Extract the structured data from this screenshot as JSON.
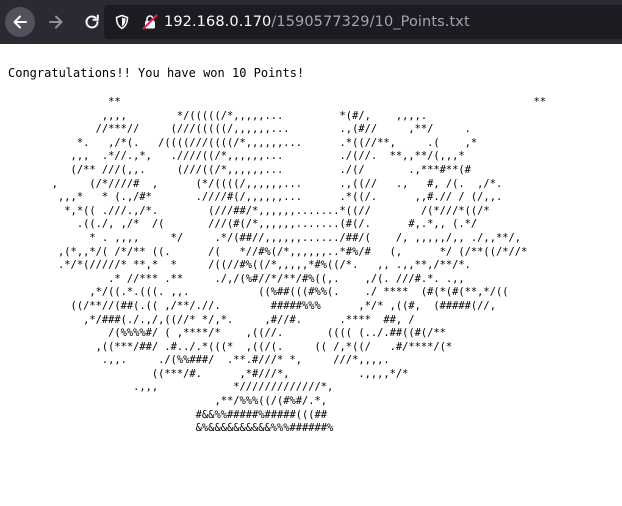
{
  "browser": {
    "url_host": "192.168.0.170",
    "url_path": "/1590577329/10_Points.txt"
  },
  "page": {
    "message": "Congratulations!! You have won 10 Points!",
    "ascii_art": "                **                                                                  **\n               ,,,,        */(((((/*,,,,,...         *(#/,    ,,,,.\n              //***//     (///(((((/,,,,,,...        .,(#//     ,**/     .\n           *.   ,/*(.   /((((///((((/*,,,,,,...      .*((//**,     .(    ,*\n          ,,,  .*//.,*,   .////((/*,,,,,,...         ./(//.  **,,**/(,,,*\n          (/** ///(,,.     (///((/*,,,,,,...         ./(/       .,***#**(#\n       ,     (/*////#  ,      (*/((((/,,,,,,...      .,((//   .,   #, /(.  ,/*.\n        ,,,*   * (.,/#*       .////#(/,,,,,,...      .*((/.      ,,#.// / (/,,.\n         *,*(( .///.,/*.        (///##/*,,,,,,.......*((//        /(*///*((/*\n           .((./, ,/*  /(       ///(#(/*,,,,,,.......(#(/.      #,.*,, (.*/\n             * . ,,,,     */     .*/(##//,,,,,,....../##/(    /, ,,,,,/,, ./,,**/,\n        ,(*,,*/( /*/** ((.      /(   *//#%(/*,,,,,,..*#%/#   (,      */ (/**((/*//*\n        .*/*(/////* **,*  *     /((//#%((/*,,,,,*#%((/*.   ,, .,,**,/**/*.\n                .* //*** .**     ./,/(%#//*/**/#%((,.    ,/(. ///#.*. .,,\n             ,*/((.*.(((. ,,.           ((%##(((#%%(.    ./ ****  (#(*(#(**,*/((\n          ((/**//(##(.(( ,/**/.//.        #####%%%      ,*/* ,((#,  (#####(//,\n            ,*/###(./.,/,((//* */,*.     ,#//#.      .****  ##, /\n                /(%%%%#/ ( ,****/*    ,((//.       (((( (../.##((#(/**\n              ,((***/##/ .#../.*(((*  ,((/(.     (( /,*((/   .#/****/(*\n               .,,.     ./(%%###/  .**.#///* *,     ///*,,,,.\n                       ((***/#.      ,*#///*,           .,,,,*/*\n                    .,,,            */////////////*,\n                                 ,**/%%%((/(#%#/.*,\n                              #&&%%#####%#####(((##\n                              &%&&&&&&&&&&%%%######%"
  },
  "colors": {
    "toolbar_bg": "#2b2a33",
    "urlbar_bg": "#1c1b22",
    "url_host": "#fbfbfe",
    "url_path": "#a4a4ad",
    "page_bg": "#ffffff"
  },
  "icons": {
    "back": "arrow-left-icon",
    "forward": "arrow-right-icon",
    "reload": "reload-icon",
    "tracking": "shield-icon",
    "security": "insecure-lock-icon"
  }
}
